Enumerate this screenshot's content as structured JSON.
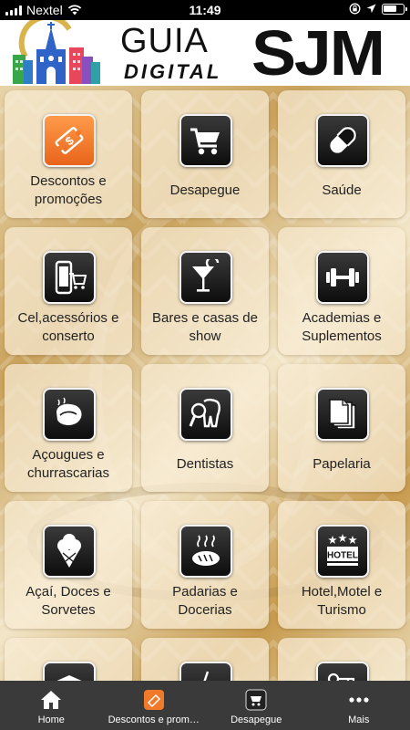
{
  "status_bar": {
    "carrier": "Nextel",
    "time": "11:49"
  },
  "header": {
    "logo_guia": "GUIA",
    "logo_digital": "DIGITAL",
    "logo_sjm": "SJM"
  },
  "tiles": [
    {
      "label": "Descontos e promoções",
      "icon": "coupon-icon"
    },
    {
      "label": "Desapegue",
      "icon": "cart-icon"
    },
    {
      "label": "Saúde",
      "icon": "pill-icon"
    },
    {
      "label": "Cel,acessórios e conserto",
      "icon": "phone-cart-icon"
    },
    {
      "label": "Bares e casas de show",
      "icon": "cocktail-icon"
    },
    {
      "label": "Academias e Suplementos",
      "icon": "dumbbell-icon"
    },
    {
      "label": "Açougues e churrascarias",
      "icon": "steak-icon"
    },
    {
      "label": "Dentistas",
      "icon": "tooth-icon"
    },
    {
      "label": "Papelaria",
      "icon": "papers-icon"
    },
    {
      "label": "Açaí, Doces e Sorvetes",
      "icon": "ice-cream-icon"
    },
    {
      "label": "Padarias e Docerias",
      "icon": "bread-icon"
    },
    {
      "label": "Hotel,Motel e Turismo",
      "icon": "hotel-icon"
    },
    {
      "label": "",
      "icon": "graduation-cap-icon"
    },
    {
      "label": "",
      "icon": "fast-food-icon"
    },
    {
      "label": "",
      "icon": "car-key-icon"
    }
  ],
  "tabbar": {
    "tabs": [
      {
        "label": "Home",
        "icon": "home-icon"
      },
      {
        "label": "Descontos e prom…",
        "icon": "coupon-icon"
      },
      {
        "label": "Desapegue",
        "icon": "cart-icon"
      },
      {
        "label": "Mais",
        "icon": "more-dots-icon"
      }
    ]
  },
  "colors": {
    "tabbar_bg": "#3a3a3a",
    "coupon_orange": "#f07a2a",
    "gold_bg": "#c9a25c"
  }
}
